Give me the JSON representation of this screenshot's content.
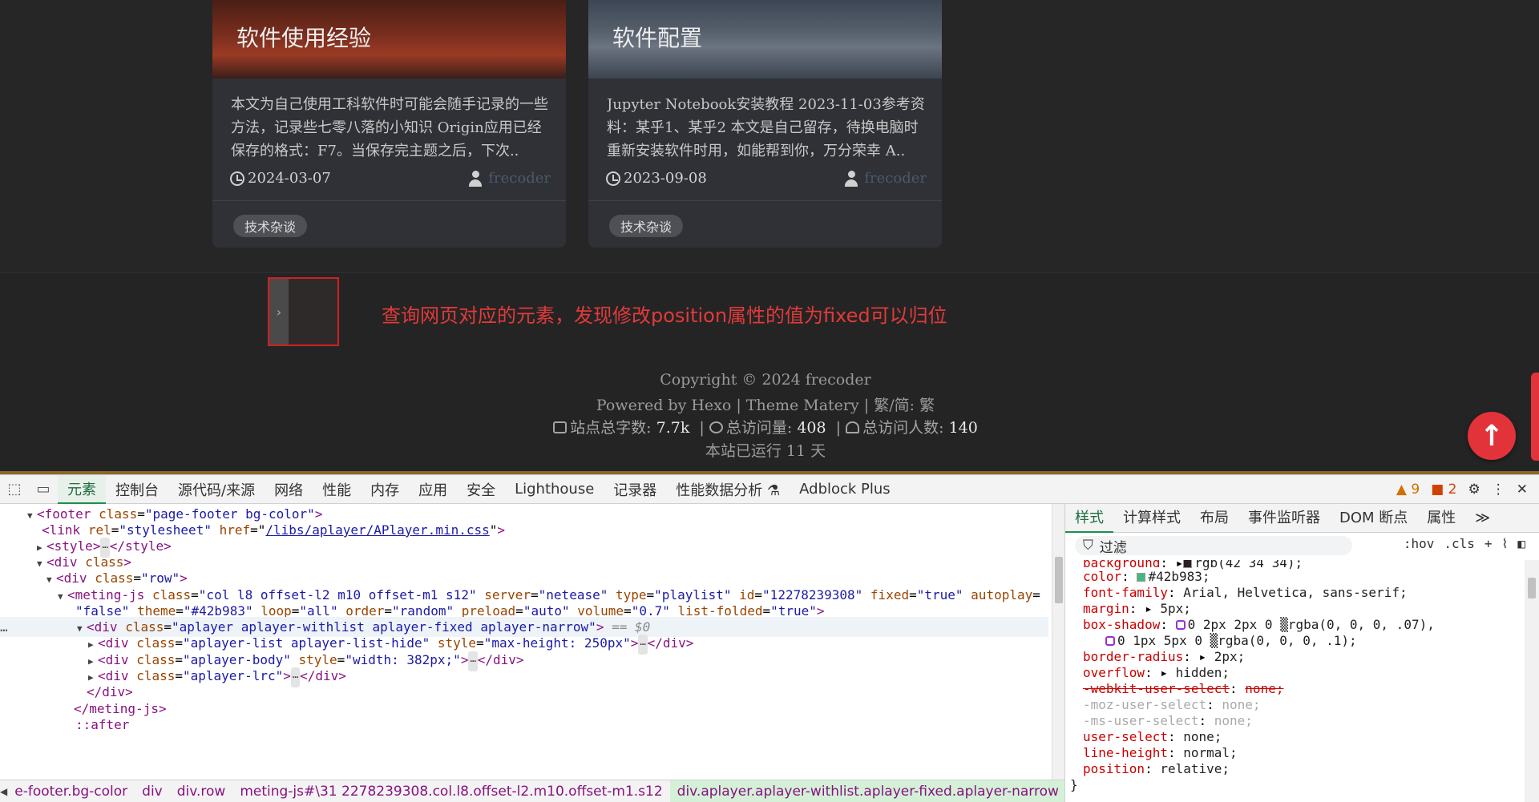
{
  "page": {
    "cards": [
      {
        "title": "软件使用经验",
        "excerpt": "本文为自己使用工科软件时可能会随手记录的一些方法，记录些七零八落的小知识 Origin应用已经保存的格式：F7。当保存完主题之后，下次..",
        "date": "2024-03-07",
        "author": "frecoder",
        "tag": "技术杂谈"
      },
      {
        "title": "软件配置",
        "excerpt": "Jupyter Notebook安装教程 2023-11-03参考资料：某乎1、某乎2 本文是自己留存，待换电脑时重新安装软件时用，如能帮到你，万分荣幸 A..",
        "date": "2023-09-08",
        "author": "frecoder",
        "tag": "技术杂谈"
      }
    ],
    "player_handle": "›",
    "annotation": "查询网页对应的元素，发现修改position属性的值为fixed可以归位",
    "footer": {
      "copyright": "Copyright © 2024 frecoder",
      "powered": "Powered by Hexo | Theme Matery | 繁/简:  繁",
      "words_label": "站点总字数:",
      "words_value": "7.7k",
      "visits_label": "总访问量:",
      "visits_value": "408",
      "visitors_label": "总访问人数:",
      "visitors_value": "140",
      "runtime": "本站已运行 11 天"
    },
    "to_top": "↑"
  },
  "devtools": {
    "tabs": [
      "元素",
      "控制台",
      "源代码/来源",
      "网络",
      "性能",
      "内存",
      "应用",
      "安全",
      "Lighthouse",
      "记录器",
      "性能数据分析 ⚗",
      "Adblock Plus"
    ],
    "warnings": "9",
    "errors": "2",
    "dom": {
      "l1_tag": "footer",
      "l1_attr": "class",
      "l1_val": "\"page-footer bg-color\"",
      "l2_tag": "link",
      "l2_a1": "rel",
      "l2_v1": "\"stylesheet\"",
      "l2_a2": "href",
      "l2_v2": "/libs/aplayer/APlayer.min.css",
      "l3_tag": "style",
      "l3_close": "style",
      "l4_tag": "div",
      "l4_attr": "class",
      "l5_tag": "div",
      "l5_attr": "class",
      "l5_val": "\"row\"",
      "l6_tag": "meting-js",
      "l6_attrs": [
        [
          "class",
          "\"col l8 offset-l2 m10 offset-m1 s12\""
        ],
        [
          "server",
          "\"netease\""
        ],
        [
          "type",
          "\"playlist\""
        ],
        [
          "id",
          "\"12278239308\""
        ],
        [
          "fixed",
          "\"true\""
        ],
        [
          "autoplay",
          ""
        ]
      ],
      "l7_attrs": [
        [
          "",
          "\"false\""
        ],
        [
          "theme",
          "\"#42b983\""
        ],
        [
          "loop",
          "\"all\""
        ],
        [
          "order",
          "\"random\""
        ],
        [
          "preload",
          "\"auto\""
        ],
        [
          "volume",
          "\"0.7\""
        ],
        [
          "list-folded",
          "\"true\""
        ]
      ],
      "l8_tag": "div",
      "l8_attr": "class",
      "l8_val": "\"aplayer aplayer-withlist aplayer-fixed aplayer-narrow\"",
      "l8_dollar": "== $0",
      "l9_tag": "div",
      "l9_attr": "class",
      "l9_val": "\"aplayer-list aplayer-list-hide\"",
      "l9_attr2": "style",
      "l9_val2": "\"max-height: 250px\"",
      "l10_tag": "div",
      "l10_attr": "class",
      "l10_val": "\"aplayer-body\"",
      "l10_attr2": "style",
      "l10_val2": "\"width: 382px;\"",
      "l11_tag": "div",
      "l11_attr": "class",
      "l11_val": "\"aplayer-lrc\"",
      "l12": "</div>",
      "l13": "</meting-js>",
      "l14": "::after",
      "gutter": "…"
    },
    "breadcrumb": [
      "e-footer.bg-color",
      "div",
      "div.row",
      "meting-js#\\31 2278239308.col.l8.offset-l2.m10.offset-m1.s12",
      "div.aplayer.aplayer-withlist.aplayer-fixed.aplayer-narrow"
    ],
    "styles_tabs": [
      "样式",
      "计算样式",
      "布局",
      "事件监听器",
      "DOM 断点",
      "属性",
      "≫"
    ],
    "filter_placeholder": "过滤",
    "filter_tools": [
      ":hov",
      ".cls",
      "+"
    ],
    "css": [
      {
        "prop": "background",
        "val": "rgb(42 34 34);",
        "swatch": "#2a2222"
      },
      {
        "prop": "color",
        "val": "#42b983;",
        "swatch": "#42b983"
      },
      {
        "prop": "font-family",
        "val": "Arial, Helvetica, sans-serif;"
      },
      {
        "prop": "margin",
        "val": "5px;"
      },
      {
        "prop": "box-shadow",
        "val": "0 2px 2px 0 ▒rgba(0, 0, 0, .07),"
      },
      {
        "prop": "",
        "val": "0 1px 5px 0 ▒rgba(0, 0, 0, .1);"
      },
      {
        "prop": "border-radius",
        "val": "2px;"
      },
      {
        "prop": "overflow",
        "val": "hidden;"
      },
      {
        "prop": "-webkit-user-select",
        "val": "none;"
      },
      {
        "prop": "-moz-user-select",
        "val": "none;"
      },
      {
        "prop": "-ms-user-select",
        "val": "none;"
      },
      {
        "prop": "user-select",
        "val": "none;"
      },
      {
        "prop": "line-height",
        "val": "normal;"
      },
      {
        "prop": "position",
        "val": "relative;"
      },
      {
        "prop": "}",
        "val": ""
      }
    ],
    "colors": {
      "accent": "#1f8f4f",
      "player_theme": "#42b983",
      "annotation": "#e23a3a"
    }
  }
}
